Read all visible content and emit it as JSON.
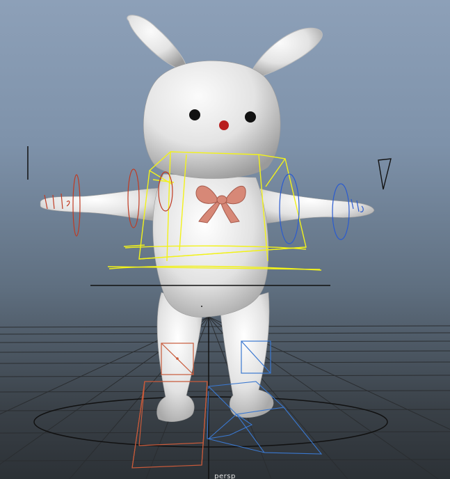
{
  "viewport": {
    "camera_name": "persp",
    "grid_color": "#2a2d30",
    "background_top": "#8da0b8",
    "background_bottom": "#2c3136"
  },
  "model": {
    "name": "bunny-character",
    "body_color": "#e8e8e8",
    "bow_color": "#d78877",
    "nose_color": "#b81f1f"
  },
  "controls": {
    "center_color": "#f2f21a",
    "left_color": "#2a5bd0",
    "right_color": "#c03a22",
    "root_color": "#111111"
  }
}
